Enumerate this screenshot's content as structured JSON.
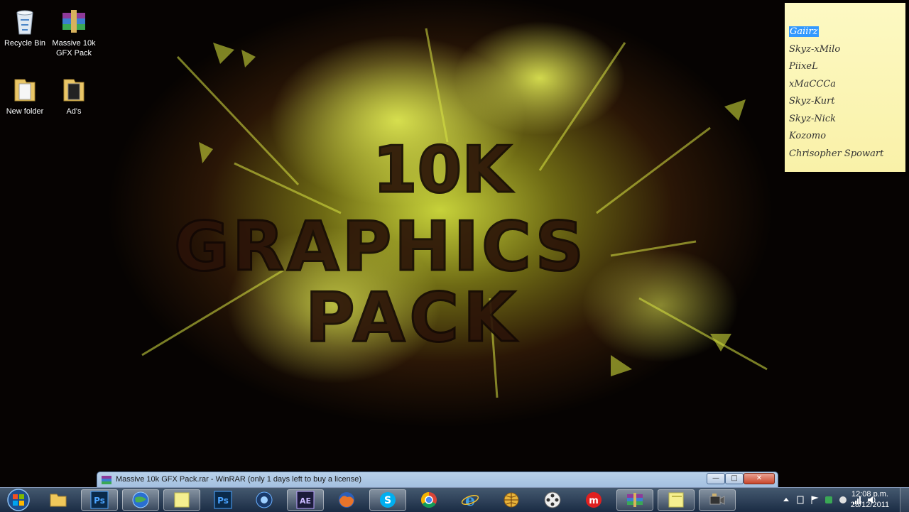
{
  "desktop": {
    "icons": [
      {
        "label": "Recycle Bin"
      },
      {
        "label": "Massive 10k GFX Pack"
      },
      {
        "label": "New folder"
      },
      {
        "label": "Ad's"
      }
    ],
    "wallpaper_text": [
      "10K",
      "GRAPHICS",
      "PACK"
    ]
  },
  "sticky_note": {
    "items": [
      "Gaiirz",
      "Skyz-xMilo",
      "PiixeL",
      "xMaCCCa",
      "Skyz-Kurt",
      "Skyz-Nick",
      "Kozomo",
      "Chrisopher Spowart"
    ],
    "selected": "Gaiirz"
  },
  "peek_window": {
    "title": "Massive 10k GFX Pack.rar - WinRAR (only 1 days left to buy a license)",
    "controls": {
      "minimize": "—",
      "maximize": "□",
      "close": "✕"
    }
  },
  "taskbar": {
    "buttons": [
      {
        "name": "windows-explorer",
        "icon": "folder-icon"
      },
      {
        "name": "photoshop",
        "icon": "photoshop-icon",
        "text": "Ps"
      },
      {
        "name": "browser-globe",
        "icon": "globe-icon"
      },
      {
        "name": "sticky-notes",
        "icon": "sticky-notes-icon"
      },
      {
        "name": "photoshop-2",
        "icon": "photoshop-icon",
        "text": "Ps"
      },
      {
        "name": "media-center",
        "icon": "media-icon"
      },
      {
        "name": "after-effects",
        "icon": "after-effects-icon",
        "text": "AE"
      },
      {
        "name": "firefox",
        "icon": "firefox-icon"
      },
      {
        "name": "skype",
        "icon": "skype-icon",
        "text": "S"
      },
      {
        "name": "chrome",
        "icon": "chrome-icon"
      },
      {
        "name": "internet-explorer",
        "icon": "ie-icon"
      },
      {
        "name": "network",
        "icon": "network-globe-icon"
      },
      {
        "name": "movie-maker",
        "icon": "film-reel-icon"
      },
      {
        "name": "app-m",
        "icon": "m-logo-icon",
        "text": "m"
      },
      {
        "name": "winrar",
        "icon": "winrar-icon"
      },
      {
        "name": "sticky-notes-2",
        "icon": "sticky-notes-icon"
      },
      {
        "name": "camera-app",
        "icon": "camcorder-icon"
      }
    ],
    "clock": {
      "time": "12:08 p.m.",
      "date": "28/12/2011"
    }
  },
  "colors": {
    "accent_yellow": "#d7e43a",
    "taskbar": "#1e3250",
    "sticky": "#fbf5b6",
    "selection": "#3399ff"
  }
}
